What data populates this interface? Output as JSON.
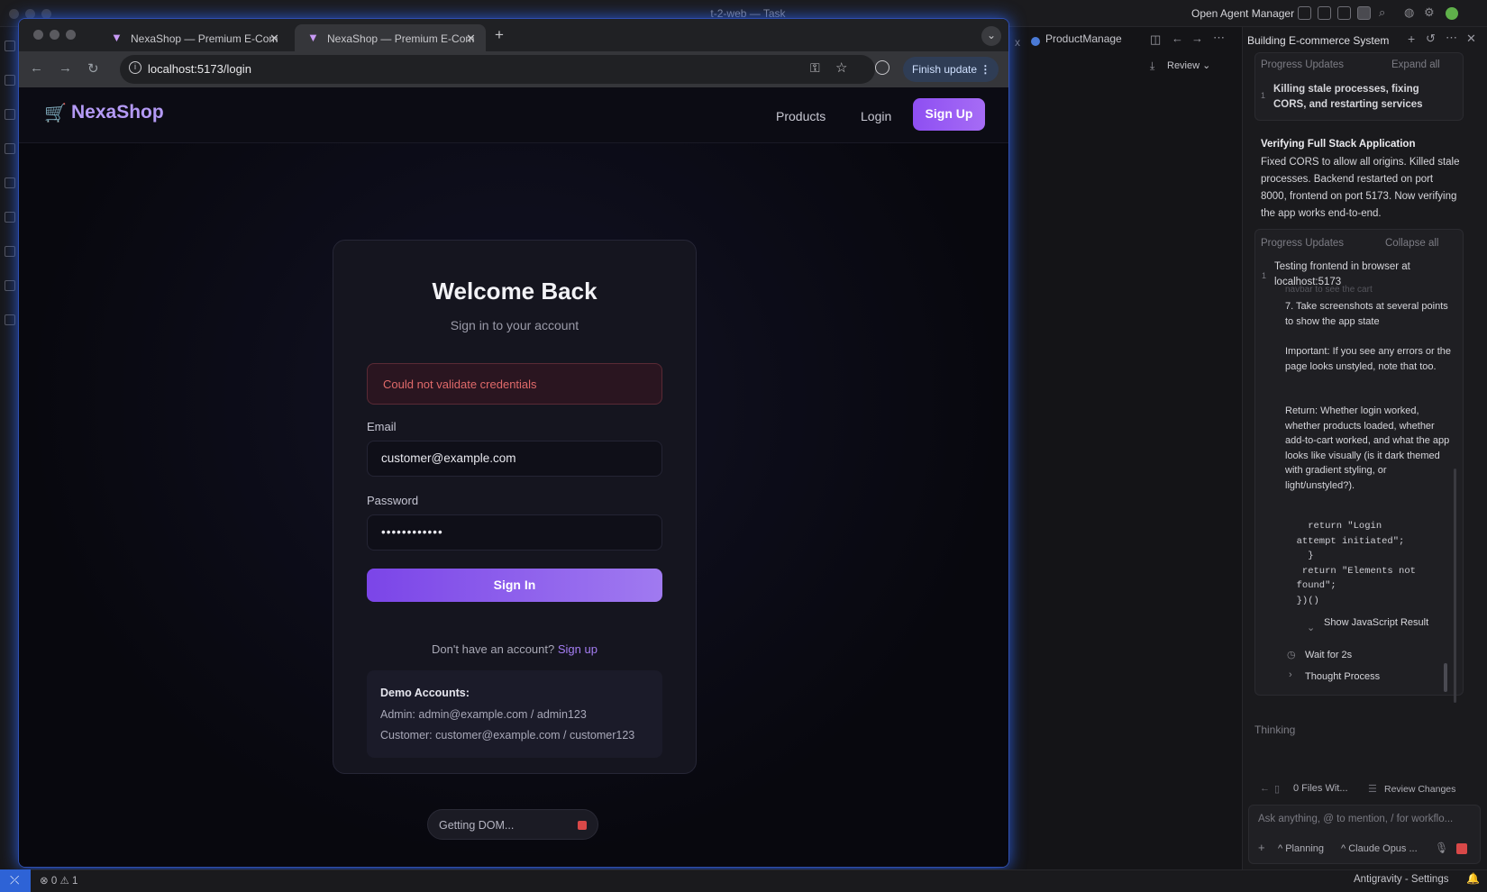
{
  "ide": {
    "title": "t-2-web — Task",
    "agent_manager": "Open Agent Manager",
    "editor_tab": "ProductManage",
    "review": "Review"
  },
  "browser": {
    "tabs": [
      {
        "label": "NexaShop — Premium E-Com"
      },
      {
        "label": "NexaShop — Premium E-Com"
      }
    ],
    "url": "localhost:5173/login",
    "finish_update": "Finish update"
  },
  "site": {
    "logo": "NexaShop",
    "nav": {
      "products": "Products",
      "login": "Login",
      "signup": "Sign Up"
    },
    "card": {
      "title": "Welcome Back",
      "subtitle": "Sign in to your account",
      "error": "Could not validate credentials",
      "email_label": "Email",
      "email_value": "customer@example.com",
      "password_label": "Password",
      "password_value": "••••••••••••",
      "signin": "Sign In",
      "no_account": "Don't have an account?",
      "signup_link": "Sign up",
      "demo_title": "Demo Accounts:",
      "demo_admin": "Admin: admin@example.com / admin123",
      "demo_customer": "Customer: customer@example.com / customer123"
    },
    "getting_dom": "Getting DOM..."
  },
  "agent": {
    "panel_title": "Building E-commerce System",
    "progress_label": "Progress Updates",
    "expand_all": "Expand all",
    "collapse_all": "Collapse all",
    "step1_num": "1",
    "step1": "Killing stale processes, fixing CORS, and restarting services",
    "verify_title": "Verifying Full Stack Application",
    "verify_body": "Fixed CORS to allow all origins. Killed stale processes. Backend restarted on port 8000, frontend on port 5173. Now verifying the app works end-to-end.",
    "step2_num": "1",
    "step2": "Testing frontend in browser at localhost:5173",
    "faded_line": "navbar to see the cart",
    "task_7": "7. Take screenshots at several points to show the app state",
    "important": "Important: If you see any errors or the page looks unstyled, note that too.",
    "return_text": "Return: Whether login worked, whether products loaded, whether add-to-cart worked, and what the app looks like visually (is it dark themed with gradient styling, or light/unstyled?).",
    "code": "    return \"Login\n  attempt initiated\";\n    }\n   return \"Elements not\n  found\";\n  })()",
    "show_js": "Show JavaScript Result",
    "wait": "Wait for 2s",
    "thought": "Thought Process",
    "thinking": "Thinking",
    "files": "0 Files Wit...",
    "review_changes": "Review Changes",
    "input_placeholder": "Ask anything, @ to mention, / for workflo...",
    "planning": "Planning",
    "model": "Claude Opus ..."
  },
  "status": {
    "errors": "0",
    "warnings": "1",
    "right": "Antigravity - Settings"
  },
  "colors": {
    "accent": "#8e4ff2",
    "error": "#e06a6a",
    "link": "#a47df2",
    "remote": "#2e63d6"
  }
}
